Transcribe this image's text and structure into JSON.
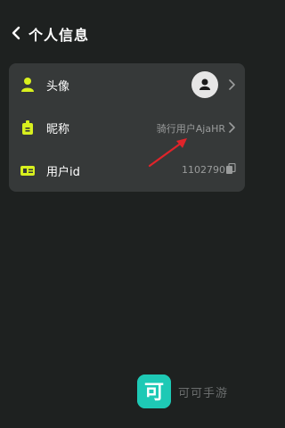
{
  "header": {
    "title": "个人信息",
    "back_icon": "chevron-left-icon"
  },
  "profile": {
    "rows": [
      {
        "label": "头像",
        "icon": "person-icon",
        "value": "",
        "trailing": "chevron-right-icon"
      },
      {
        "label": "昵称",
        "icon": "name-tag-icon",
        "value": "骑行用户AjaHR",
        "trailing": "chevron-right-icon"
      },
      {
        "label": "用户id",
        "icon": "id-card-icon",
        "value": "1102790",
        "trailing": "copy-icon"
      }
    ]
  },
  "colors": {
    "accent": "#d8f01e",
    "background": "#1e2120",
    "card": "#363939",
    "annotation_arrow": "#e0242a",
    "watermark_logo": "#1ec9b5"
  },
  "watermark": {
    "logo_char": "可",
    "text": "可可手游"
  }
}
